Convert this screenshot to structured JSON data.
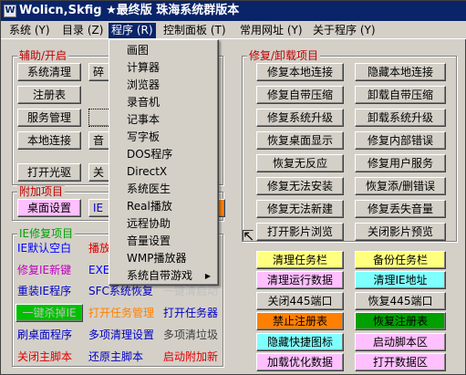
{
  "window": {
    "title": "Wolicn,Skfig ★最终版 珠海系统群版本"
  },
  "menubar": [
    {
      "label": "系统 (Y)"
    },
    {
      "label": "目录 (Z)"
    },
    {
      "label": "程序 (R)"
    },
    {
      "label": "控制面板 (T)"
    },
    {
      "label": "常用网址 (Y)"
    },
    {
      "label": "关于程序 (Y)"
    }
  ],
  "program_menu": [
    {
      "label": "画图"
    },
    {
      "label": "计算器"
    },
    {
      "label": "浏览器"
    },
    {
      "label": "录音机"
    },
    {
      "label": "记事本"
    },
    {
      "label": "写字板"
    },
    {
      "label": "DOS程序"
    },
    {
      "label": "DirectX"
    },
    {
      "label": "系统医生"
    },
    {
      "label": "Real播放"
    },
    {
      "label": "远程协助"
    },
    {
      "label": "音量设置"
    },
    {
      "label": "WMP播放器"
    },
    {
      "label": "系统自带游戏"
    }
  ],
  "helper_group": {
    "title": "辅助/开启",
    "left_buttons": [
      "系统清理",
      "注册表",
      "服务管理",
      "本地连接",
      "打开光驱"
    ],
    "right_fragments": [
      "碎",
      "",
      "",
      "音",
      "关"
    ]
  },
  "addon_group": {
    "title": "附加项目",
    "buttons": [
      "桌面设置",
      "IE"
    ]
  },
  "ie_group": {
    "title": "IE修复项目",
    "rows": [
      [
        "IE默认空白",
        "播放",
        "",
        ""
      ],
      [
        "修复IE新键",
        "EXE",
        "",
        ""
      ],
      [
        "重装IE程序",
        "SFC系统恢复",
        "一键清启动",
        ""
      ],
      [
        "一键杀掉IE",
        "打开任务管理",
        "打开任务器",
        ""
      ],
      [
        "刷桌面程序",
        "多项清理设置",
        "多项清垃圾",
        ""
      ],
      [
        "关闭主脚本",
        "还原主脚本",
        "启动附加新",
        ""
      ]
    ]
  },
  "repair_group": {
    "title": "修复/卸载项目",
    "left": [
      "修复本地连接",
      "修复自带压缩",
      "修复系统升级",
      "恢复桌面显示",
      "恢复无反应",
      "修复无法安装",
      "修复无法新建",
      "打开影片浏览"
    ],
    "right": [
      "隐藏本地连接",
      "卸载自带压缩",
      "卸载系统升级",
      "修复内部错误",
      "修复用户服务",
      "恢复添/删错误",
      "修复丢失音量",
      "关闭影片预览"
    ]
  },
  "task_buttons": {
    "left": [
      "清理任务栏",
      "清理运行数据",
      "关闭445端口",
      "禁止注册表",
      "隐藏快捷图标",
      "加载优化数据"
    ],
    "right": [
      "备份任务栏",
      "清理IE地址",
      "恢复445端口",
      "恢复注册表",
      "启动脚本区",
      "打开数据区"
    ]
  },
  "colors": {
    "title_bg": "#0a246a",
    "group_label": "#c00000",
    "yellow": "#ffff80",
    "pink": "#ffc0ff",
    "cyan": "#80ffff",
    "orange": "#ff8000",
    "green": "#00c000",
    "blue": "#0000ff",
    "magenta": "#c000c0",
    "red": "#e00000"
  }
}
